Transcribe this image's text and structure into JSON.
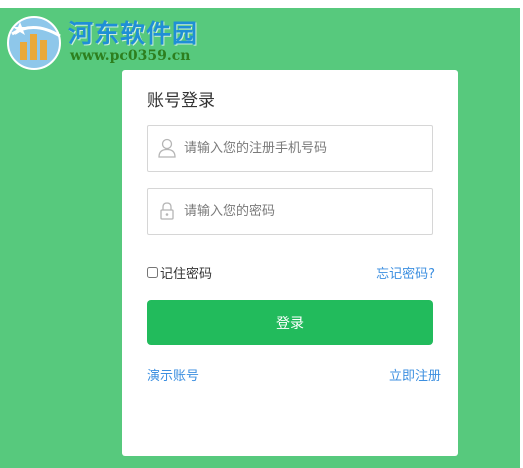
{
  "watermark": {
    "title": "河东软件园",
    "url": "www.pc0359.cn"
  },
  "login": {
    "title": "账号登录",
    "phone_placeholder": "请输入您的注册手机号码",
    "password_placeholder": "请输入您的密码",
    "remember_label": "记住密码",
    "forgot_label": "忘记密码?",
    "submit_label": "登录",
    "demo_label": "演示账号",
    "register_label": "立即注册"
  },
  "colors": {
    "background": "#57c97d",
    "primary_button": "#22bb5c",
    "link": "#3c8fe0"
  },
  "icons": {
    "phone_field": "user-icon",
    "password_field": "lock-icon",
    "watermark": "watermark-logo"
  }
}
